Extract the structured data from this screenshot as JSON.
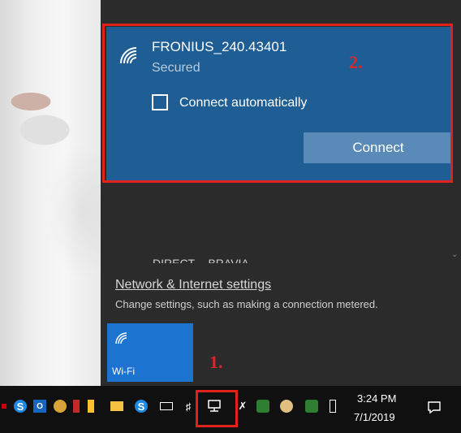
{
  "wifi_card": {
    "network_name": "FRONIUS_240.43401",
    "status": "Secured",
    "connect_automatically_label": "Connect automatically",
    "connect_automatically_checked": false,
    "connect_button_label": "Connect"
  },
  "annotations": {
    "step_1": "1.",
    "step_2": "2.",
    "highlight_color": "#e1221c"
  },
  "other_network_partial": "DIRECT-..-BRAVIA",
  "settings": {
    "link_label": "Network & Internet settings",
    "description": "Change settings, such as making a connection metered."
  },
  "quick_action": {
    "label": "Wi-Fi",
    "icon": "wifi-icon",
    "active": true,
    "color": "#1c73d0"
  },
  "taskbar": {
    "time": "3:24 PM",
    "date": "7/1/2019",
    "tray_icons": [
      "skype-icon",
      "outlook-icon",
      "globe-icon",
      "flag-icon",
      "mail-icon",
      "skype-business-icon",
      "battery-icon",
      "volume-icon",
      "network-icon",
      "tools-icon",
      "shield-icon",
      "app-icon",
      "security-icon",
      "pen-icon",
      "notification-icon"
    ]
  },
  "colors": {
    "panel_bg": "#2b2b2b",
    "card_bg": "#1f5e94",
    "button_bg": "#5a8ab7"
  }
}
